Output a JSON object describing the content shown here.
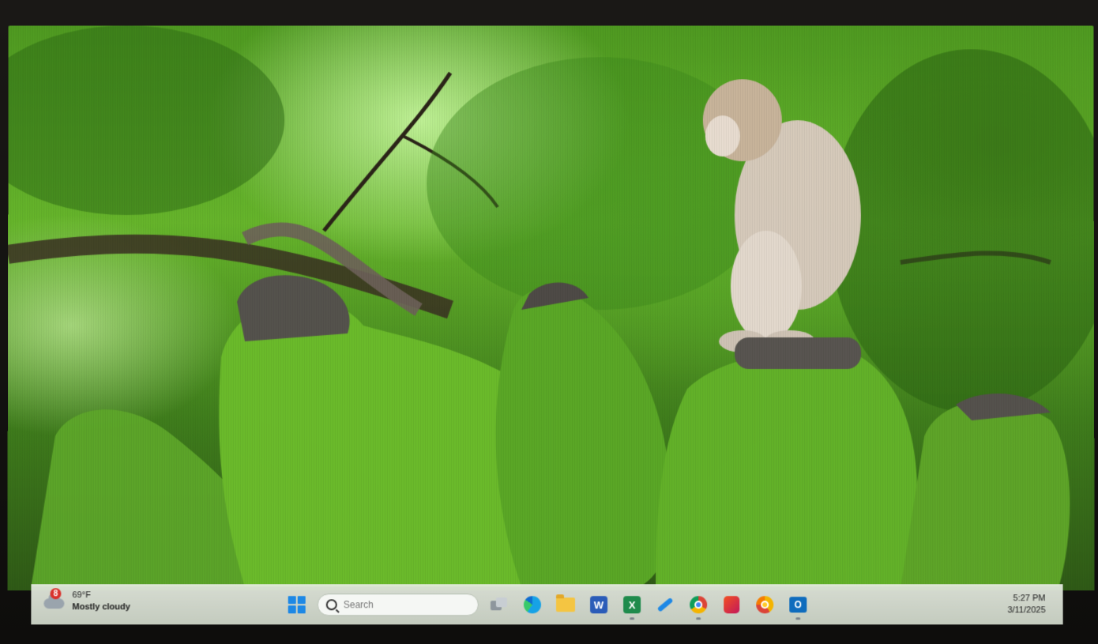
{
  "weather": {
    "badge": "8",
    "temperature": "69°F",
    "condition": "Mostly cloudy",
    "icon": "cloud-icon"
  },
  "search": {
    "placeholder": "Search"
  },
  "taskbar": {
    "apps": [
      {
        "name": "start",
        "icon": "windows-start-icon"
      },
      {
        "name": "task-view",
        "icon": "task-view-icon"
      },
      {
        "name": "edge",
        "icon": "edge-browser-icon"
      },
      {
        "name": "file-explorer",
        "icon": "folder-icon"
      },
      {
        "name": "word",
        "icon": "word-icon",
        "glyph": "W"
      },
      {
        "name": "excel",
        "icon": "excel-icon",
        "glyph": "X"
      },
      {
        "name": "pen",
        "icon": "pen-icon"
      },
      {
        "name": "chrome",
        "icon": "chrome-icon"
      },
      {
        "name": "office",
        "icon": "office-icon"
      },
      {
        "name": "chrome-canary",
        "icon": "chrome-canary-icon"
      },
      {
        "name": "outlook",
        "icon": "outlook-icon",
        "glyph": "O"
      }
    ]
  },
  "clock": {
    "time": "5:27 PM",
    "date": "3/11/2025"
  },
  "colors": {
    "accent": "#1e88e5",
    "badge": "#d9312b"
  }
}
